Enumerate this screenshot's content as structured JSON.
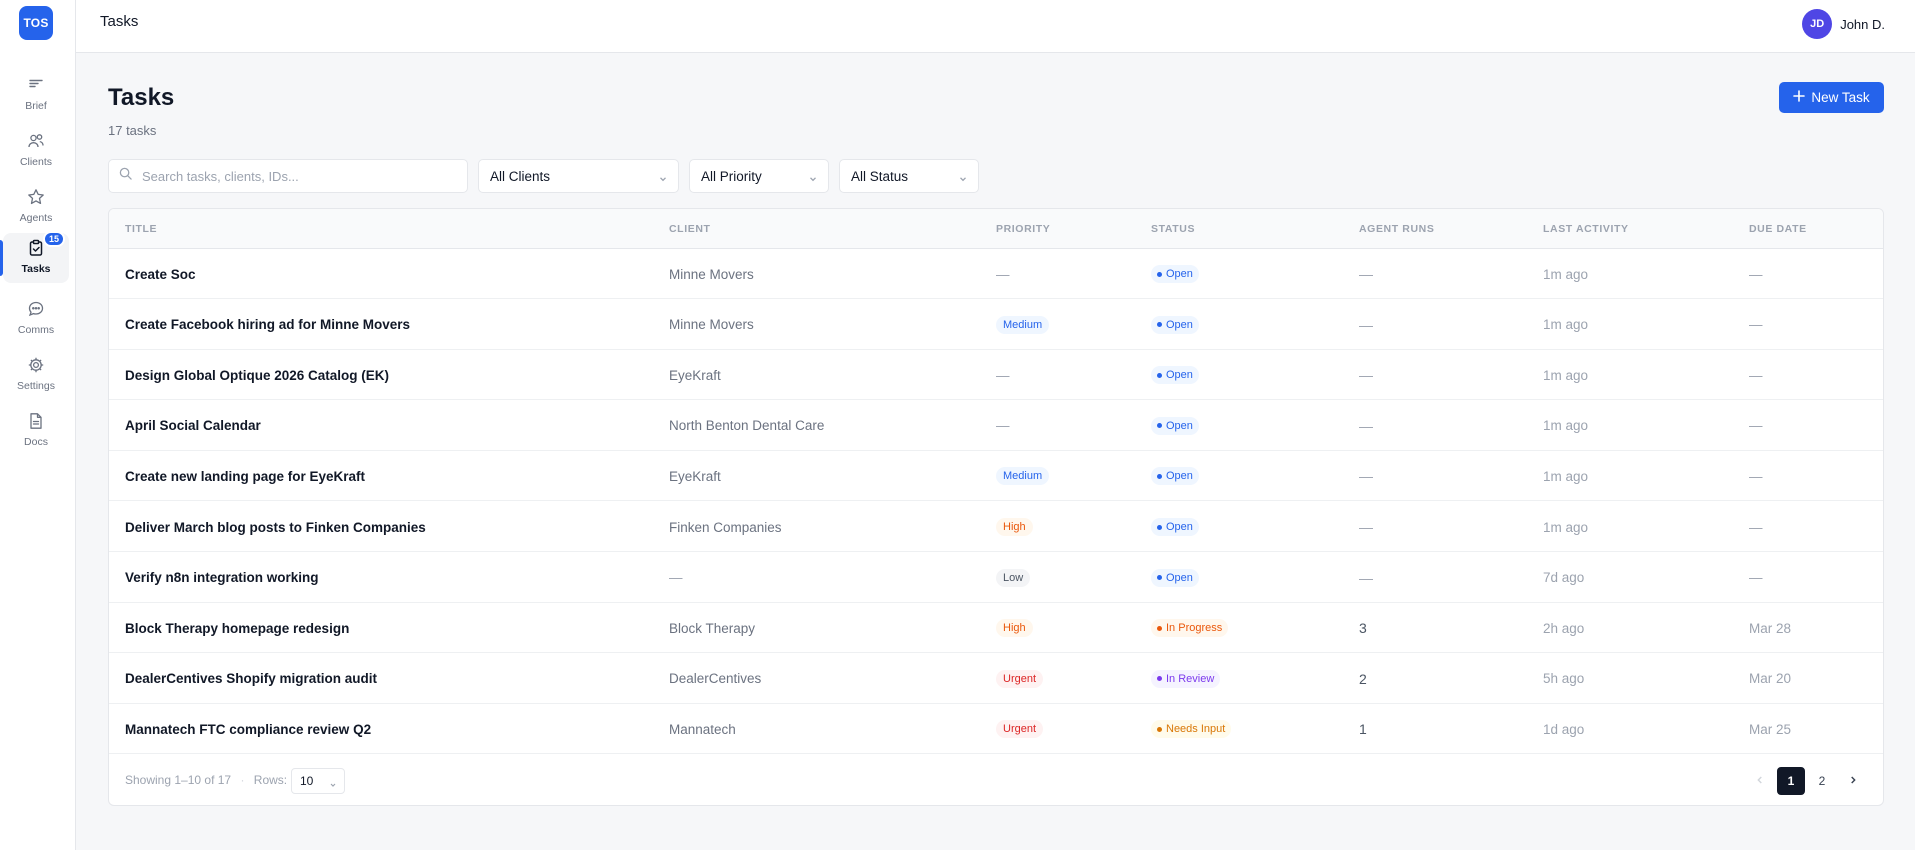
{
  "app": {
    "logo": "TOS",
    "topbar_title": "Tasks"
  },
  "user": {
    "initials": "JD",
    "name": "John D."
  },
  "sidebar": {
    "items": [
      {
        "label": "Brief",
        "icon": "brief-icon"
      },
      {
        "label": "Clients",
        "icon": "users-icon"
      },
      {
        "label": "Agents",
        "icon": "star-icon"
      },
      {
        "label": "Tasks",
        "icon": "clipboard-check-icon",
        "badge": "15",
        "active": true
      },
      {
        "label": "Comms",
        "icon": "chat-bubble-icon"
      },
      {
        "label": "Settings",
        "icon": "gear-icon"
      },
      {
        "label": "Docs",
        "icon": "document-icon"
      }
    ]
  },
  "header": {
    "title": "Tasks",
    "count": "17 tasks",
    "new_button": "New Task"
  },
  "filters": {
    "search_placeholder": "Search tasks, clients, IDs...",
    "clients": "All Clients",
    "priority": "All Priority",
    "status": "All Status"
  },
  "table": {
    "columns": [
      "TITLE",
      "CLIENT",
      "PRIORITY",
      "STATUS",
      "AGENT RUNS",
      "LAST ACTIVITY",
      "DUE DATE"
    ],
    "rows": [
      {
        "title": "Create Soc",
        "client": "Minne Movers",
        "priority": "—",
        "status": "Open",
        "runs": "—",
        "last": "1m ago",
        "due": "—"
      },
      {
        "title": "Create Facebook hiring ad for Minne Movers",
        "client": "Minne Movers",
        "priority": "Medium",
        "status": "Open",
        "runs": "—",
        "last": "1m ago",
        "due": "—"
      },
      {
        "title": "Design Global Optique 2026 Catalog (EK)",
        "client": "EyeKraft",
        "priority": "—",
        "status": "Open",
        "runs": "—",
        "last": "1m ago",
        "due": "—"
      },
      {
        "title": "April Social Calendar",
        "client": "North Benton Dental Care",
        "priority": "—",
        "status": "Open",
        "runs": "—",
        "last": "1m ago",
        "due": "—"
      },
      {
        "title": "Create new landing page for EyeKraft",
        "client": "EyeKraft",
        "priority": "Medium",
        "status": "Open",
        "runs": "—",
        "last": "1m ago",
        "due": "—"
      },
      {
        "title": "Deliver March blog posts to Finken Companies",
        "client": "Finken Companies",
        "priority": "High",
        "status": "Open",
        "runs": "—",
        "last": "1m ago",
        "due": "—"
      },
      {
        "title": "Verify n8n integration working",
        "client": "—",
        "priority": "Low",
        "status": "Open",
        "runs": "—",
        "last": "7d ago",
        "due": "—"
      },
      {
        "title": "Block Therapy homepage redesign",
        "client": "Block Therapy",
        "priority": "High",
        "status": "In Progress",
        "runs": "3",
        "last": "2h ago",
        "due": "Mar 28"
      },
      {
        "title": "DealerCentives Shopify migration audit",
        "client": "DealerCentives",
        "priority": "Urgent",
        "status": "In Review",
        "runs": "2",
        "last": "5h ago",
        "due": "Mar 20"
      },
      {
        "title": "Mannatech FTC compliance review Q2",
        "client": "Mannatech",
        "priority": "Urgent",
        "status": "Needs Input",
        "runs": "1",
        "last": "1d ago",
        "due": "Mar 25"
      }
    ]
  },
  "footer": {
    "showing": "Showing 1–10 of 17",
    "separator": "·",
    "rows_label": "Rows:",
    "rows_value": "10",
    "pages": [
      "1",
      "2"
    ],
    "current_page": "1"
  },
  "colors": {
    "accent": "#2563eb",
    "priority": {
      "Medium": {
        "bg": "#eff6ff",
        "fg": "#2563eb"
      },
      "High": {
        "bg": "#fff7ed",
        "fg": "#ea580c"
      },
      "Low": {
        "bg": "#f3f4f6",
        "fg": "#4b5563"
      },
      "Urgent": {
        "bg": "#fef2f2",
        "fg": "#dc2626"
      }
    },
    "status": {
      "Open": {
        "bg": "#eff6ff",
        "fg": "#2563eb"
      },
      "In Progress": {
        "bg": "#fff7ed",
        "fg": "#ea580c"
      },
      "In Review": {
        "bg": "#f5f3ff",
        "fg": "#7c3aed"
      },
      "Needs Input": {
        "bg": "#fffbeb",
        "fg": "#d97706"
      }
    }
  }
}
